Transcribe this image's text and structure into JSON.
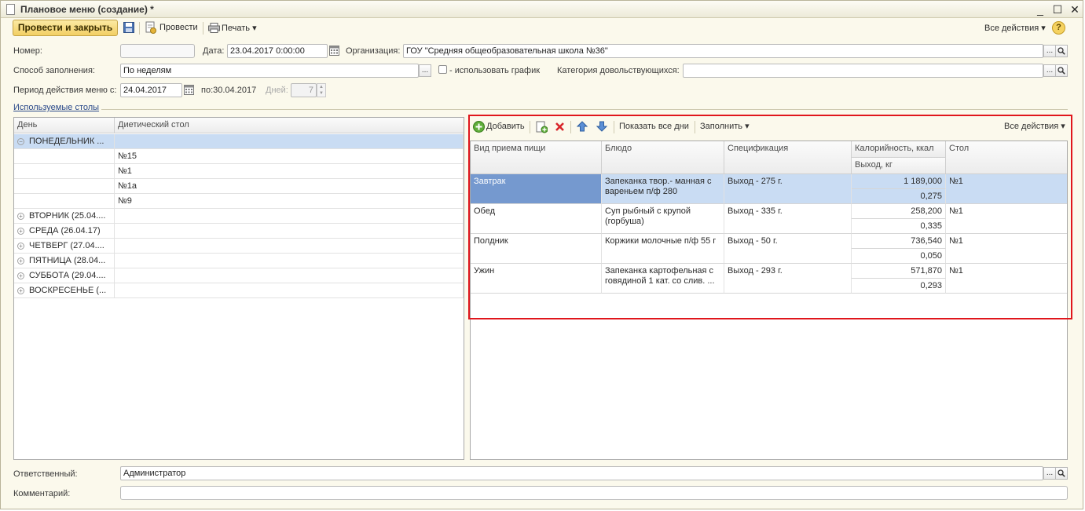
{
  "window": {
    "title": "Плановое меню (создание) *",
    "minimize": "_",
    "maximize": "☐",
    "close": "✕"
  },
  "toolbar": {
    "post_and_close": "Провести и закрыть",
    "post": "Провести",
    "print": "Печать",
    "all_actions": "Все действия",
    "help": "?"
  },
  "form": {
    "number_label": "Номер:",
    "number_value": "",
    "date_label": "Дата:",
    "date_value": "23.04.2017  0:00:00",
    "org_label": "Организация:",
    "org_value": "ГОУ \"Средняя общеобразовательная школа №36\"",
    "fill_method_label": "Способ заполнения:",
    "fill_method_value": "По неделям",
    "use_schedule_label": "- использовать график",
    "category_label": "Категория довольствующихся:",
    "category_value": "",
    "period_label": "Период действия меню с:",
    "period_from": "24.04.2017",
    "period_to_label": "по:30.04.2017",
    "days_label": "Дней:",
    "days_value": "7",
    "used_tables_label": "Используемые столы"
  },
  "left_table": {
    "headers": [
      "День",
      "Диетический стол"
    ],
    "expanded_day": "ПОНЕДЕЛЬНИК ...",
    "tables": [
      "№15",
      "№1",
      "№1а",
      "№9"
    ],
    "collapsed_days": [
      "ВТОРНИК (25.04....",
      "СРЕДА (26.04.17)",
      "ЧЕТВЕРГ (27.04....",
      "ПЯТНИЦА (28.04...",
      "СУББОТА (29.04....",
      "ВОСКРЕСЕНЬЕ (..."
    ]
  },
  "right_toolbar": {
    "add": "Добавить",
    "show_all_days": "Показать все дни",
    "fill": "Заполнить",
    "all_actions": "Все действия"
  },
  "right_table": {
    "headers": {
      "meal": "Вид приема пищи",
      "dish": "Блюдо",
      "spec": "Спецификация",
      "calories": "Калорийность, ккал",
      "yield": "Выход, кг",
      "table": "Стол"
    },
    "rows": [
      {
        "meal": "Завтрак",
        "dish": "Запеканка твор.- манная с вареньем п/ф 280",
        "spec": "Выход - 275 г.",
        "calories": "1 189,000",
        "yield": "0,275",
        "table": "№1"
      },
      {
        "meal": "Обед",
        "dish": "Суп рыбный с крупой (горбуша)",
        "spec": "Выход - 335 г.",
        "calories": "258,200",
        "yield": "0,335",
        "table": "№1"
      },
      {
        "meal": "Полдник",
        "dish": "Коржики молочные п/ф 55 г",
        "spec": "Выход - 50 г.",
        "calories": "736,540",
        "yield": "0,050",
        "table": "№1"
      },
      {
        "meal": "Ужин",
        "dish": "Запеканка картофельная с говядиной 1 кат. со слив. ...",
        "spec": "Выход - 293 г.",
        "calories": "571,870",
        "yield": "0,293",
        "table": "№1"
      }
    ]
  },
  "footer": {
    "responsible_label": "Ответственный:",
    "responsible_value": "Администратор",
    "comment_label": "Комментарий:",
    "comment_value": ""
  },
  "colors": {
    "form_bg": "#fbf9ec",
    "primary_button": "#f2cf64",
    "selection": "#c9dcf3",
    "selected_cell": "#7599cf",
    "highlight_border": "#e0161c"
  },
  "icons": [
    "document-icon",
    "save-icon",
    "post-icon",
    "print-icon",
    "calendar-icon",
    "add-icon",
    "copy-icon",
    "delete-icon",
    "move-up-icon",
    "move-down-icon",
    "select-icon",
    "search-icon",
    "help-icon"
  ]
}
